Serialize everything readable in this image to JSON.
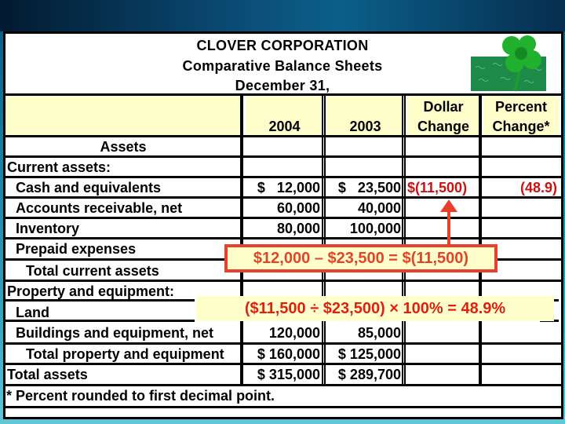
{
  "header": {
    "company": "CLOVER CORPORATION",
    "report": "Comparative Balance Sheets",
    "date": "December 31,"
  },
  "columns": {
    "year1": "2004",
    "year2": "2003",
    "dollar_change_line1": "Dollar",
    "dollar_change_line2": "Change",
    "percent_change_line1": "Percent",
    "percent_change_line2": "Change*"
  },
  "rows": [
    {
      "label": "Assets",
      "y2004": "",
      "y2003": "",
      "dollar": "",
      "percent": ""
    },
    {
      "label": "Current assets:",
      "y2004": "",
      "y2003": "",
      "dollar": "",
      "percent": ""
    },
    {
      "label": "Cash and equivalents",
      "y2004": "$   12,000",
      "y2003": "$   23,500",
      "dollar": "$(11,500)",
      "percent": "(48.9)"
    },
    {
      "label": "Accounts receivable, net",
      "y2004": "60,000",
      "y2003": "40,000",
      "dollar": "",
      "percent": ""
    },
    {
      "label": "Inventory",
      "y2004": "80,000",
      "y2003": "100,000",
      "dollar": "",
      "percent": ""
    },
    {
      "label": "Prepaid expenses",
      "y2004": "",
      "y2003": "",
      "dollar": "",
      "percent": ""
    },
    {
      "label": "Total current assets",
      "y2004": "",
      "y2003": "",
      "dollar": "",
      "percent": ""
    },
    {
      "label": "Property and equipment:",
      "y2004": "",
      "y2003": "",
      "dollar": "",
      "percent": ""
    },
    {
      "label": "Land",
      "y2004": "",
      "y2003": "",
      "dollar": "",
      "percent": ""
    },
    {
      "label": "Buildings and equipment, net",
      "y2004": "120,000",
      "y2003": "85,000",
      "dollar": "",
      "percent": ""
    },
    {
      "label": "Total property and equipment",
      "y2004": "$ 160,000",
      "y2003": "$ 125,000",
      "dollar": "",
      "percent": ""
    },
    {
      "label": "Total assets",
      "y2004": "$ 315,000",
      "y2003": "$ 289,700",
      "dollar": "",
      "percent": ""
    }
  ],
  "footnote": "* Percent rounded to first decimal point.",
  "callouts": {
    "dollar_formula": "$12,000 – $23,500 = $(11,500)",
    "percent_formula": "($11,500 ÷ $23,500) × 100% = 48.9%"
  },
  "logo": "four-leaf-clover",
  "colors": {
    "header_fill": "#ffffcc",
    "highlight_red": "#cc1111",
    "callout_border": "#e8402a",
    "clover_green": "#1aa82a"
  }
}
